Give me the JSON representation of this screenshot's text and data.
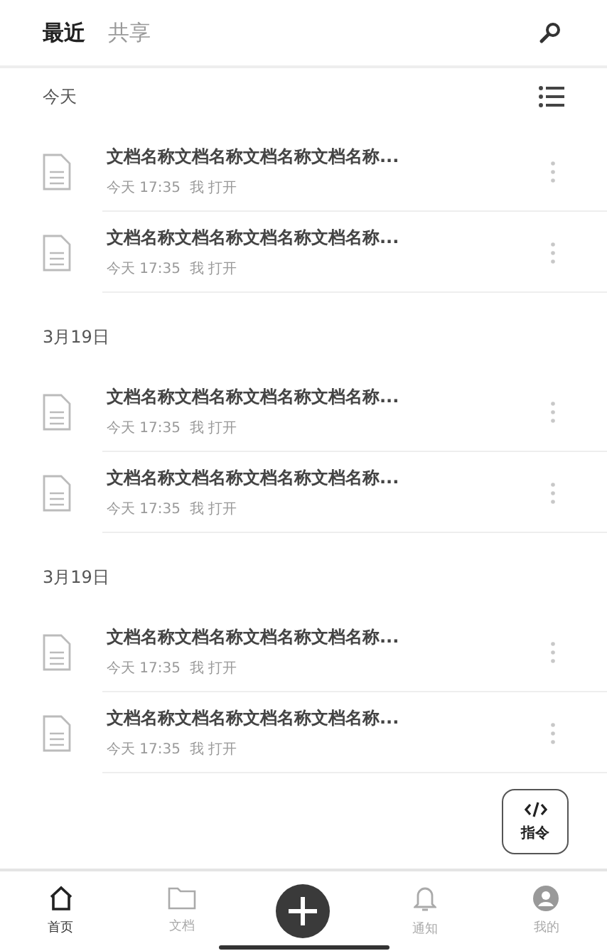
{
  "tabs": [
    {
      "label": "最近",
      "selected": true
    },
    {
      "label": "共享",
      "selected": false
    }
  ],
  "groups": [
    {
      "label": "今天",
      "files": [
        {
          "name": "文档名称文档名称文档名称文档名称...",
          "meta": "今天 17:35  我 打开"
        },
        {
          "name": "文档名称文档名称文档名称文档名称...",
          "meta": "今天 17:35  我 打开"
        }
      ]
    },
    {
      "label": "3月19日",
      "files": [
        {
          "name": "文档名称文档名称文档名称文档名称...",
          "meta": "今天 17:35  我 打开"
        },
        {
          "name": "文档名称文档名称文档名称文档名称...",
          "meta": "今天 17:35  我 打开"
        }
      ]
    },
    {
      "label": "3月19日",
      "files": [
        {
          "name": "文档名称文档名称文档名称文档名称...",
          "meta": "今天 17:35  我 打开"
        },
        {
          "name": "文档名称文档名称文档名称文档名称...",
          "meta": "今天 17:35  我 打开"
        }
      ]
    }
  ],
  "command_button": {
    "label": "指令"
  },
  "nav": [
    {
      "kind": "home",
      "label": "首页",
      "selected": true
    },
    {
      "kind": "folder",
      "label": "文档",
      "selected": false
    },
    {
      "kind": "add"
    },
    {
      "kind": "bell",
      "label": "通知",
      "selected": false
    },
    {
      "kind": "user",
      "label": "我的",
      "selected": false
    }
  ]
}
